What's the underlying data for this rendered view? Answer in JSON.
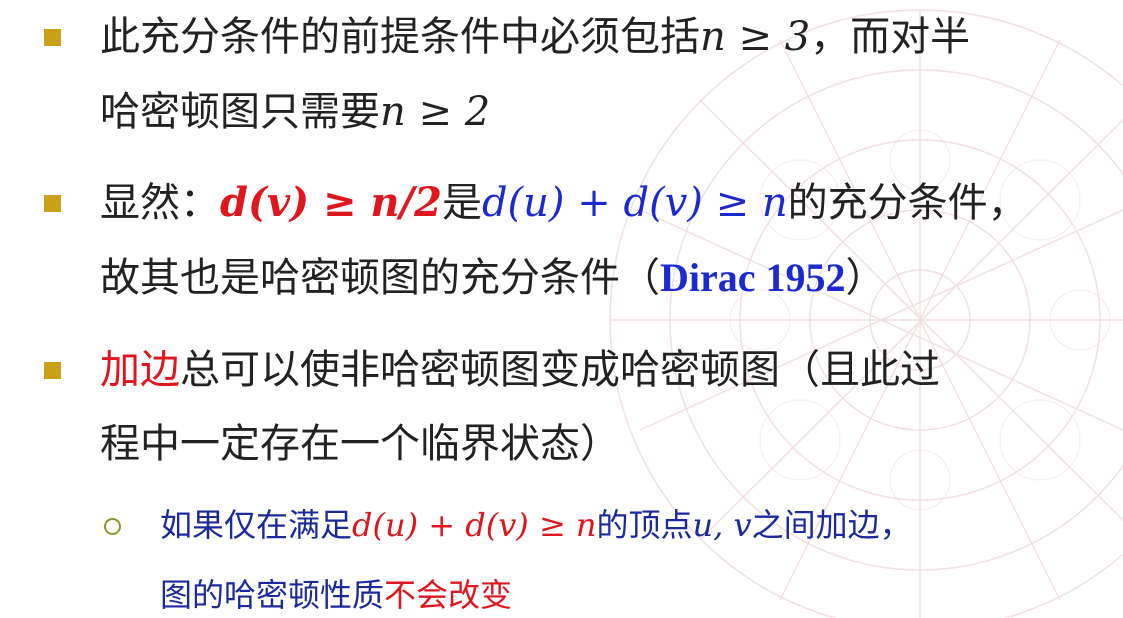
{
  "items": [
    {
      "line1": {
        "text": "此充分条件的前提条件中必须包括",
        "math": "n ≥ 3",
        "tail": "，而对半"
      },
      "line2": {
        "text": "哈密顿图只需要",
        "math": "n ≥ 2"
      }
    },
    {
      "line1": {
        "prefix": "显然：",
        "math_red": "d(v) ≥ n/2",
        "mid": "是",
        "math_blue": "d(u) + d(v) ≥ n",
        "tail": "的充分条件，"
      },
      "line2": {
        "text": "故其也是哈密顿图的充分条件（",
        "cite": "Dirac 1952",
        "close": "）"
      }
    },
    {
      "line1": {
        "red": "加边",
        "text": "总可以使非哈密顿图变成哈密顿图（且此过"
      },
      "line2": {
        "text": "程中一定存在一个临界状态）"
      }
    }
  ],
  "sub_item": {
    "line1": {
      "text": "如果仅在满足",
      "math_red": "d(u) + d(v) ≥ n",
      "mid": "的顶点",
      "math": "u, v",
      "tail": "之间加边，"
    },
    "line2": {
      "text": "图的哈密顿性质",
      "red": "不会改变"
    }
  },
  "colors": {
    "bullet": "#c9a21a",
    "sub_bullet": "#8a9a2a",
    "red": "#e0161f",
    "blue": "#1a2ad0"
  }
}
